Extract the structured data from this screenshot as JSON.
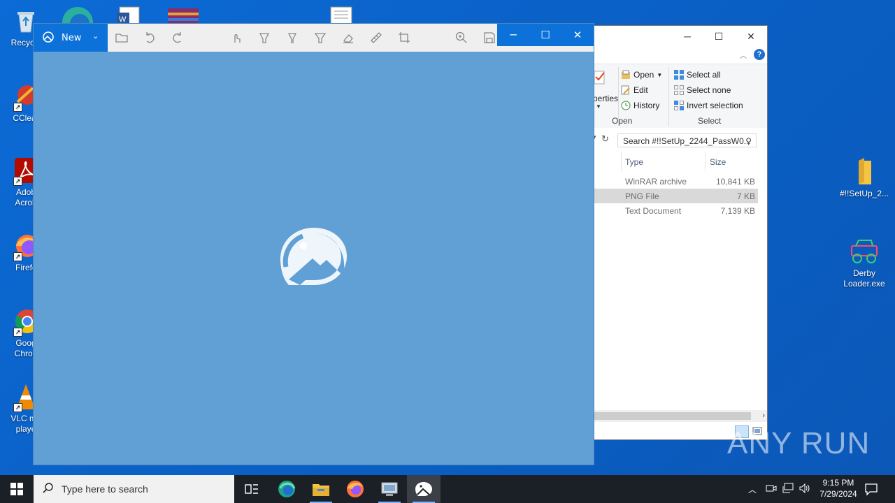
{
  "desktop": {
    "icons_left": [
      {
        "label": "Recycle"
      },
      {
        "label": "CClear"
      },
      {
        "label": "Adob\nAcrob"
      },
      {
        "label": "Firefc"
      },
      {
        "label": "Goog\nChron"
      },
      {
        "label": "VLC me\nplaye"
      }
    ],
    "icons_right": [
      {
        "label": "#!!SetUp_2..."
      },
      {
        "label": "Derby\nLoader.exe"
      }
    ]
  },
  "photos": {
    "new_label": "New"
  },
  "explorer": {
    "ribbon": {
      "properties_label": "perties",
      "open_label": "Open",
      "edit_label": "Edit",
      "history_label": "History",
      "open_group": "Open",
      "select_all": "Select all",
      "select_none": "Select none",
      "invert_selection": "Invert selection",
      "select_group": "Select"
    },
    "search_placeholder": "Search #!!SetUp_2244_PassW0...",
    "columns": {
      "type": "Type",
      "size": "Size"
    },
    "files": [
      {
        "type": "WinRAR archive",
        "size": "10,841 KB"
      },
      {
        "type": "PNG File",
        "size": "7 KB"
      },
      {
        "type": "Text Document",
        "size": "7,139 KB"
      }
    ]
  },
  "taskbar": {
    "search_placeholder": "Type here to search",
    "time": "9:15 PM",
    "date": "7/29/2024"
  },
  "watermark": "ANY RUN",
  "colors": {
    "accent": "#0c72d9",
    "photos_bg": "#61a0d5",
    "desktop": "#0a63c9",
    "taskbar": "#1b1f26"
  }
}
